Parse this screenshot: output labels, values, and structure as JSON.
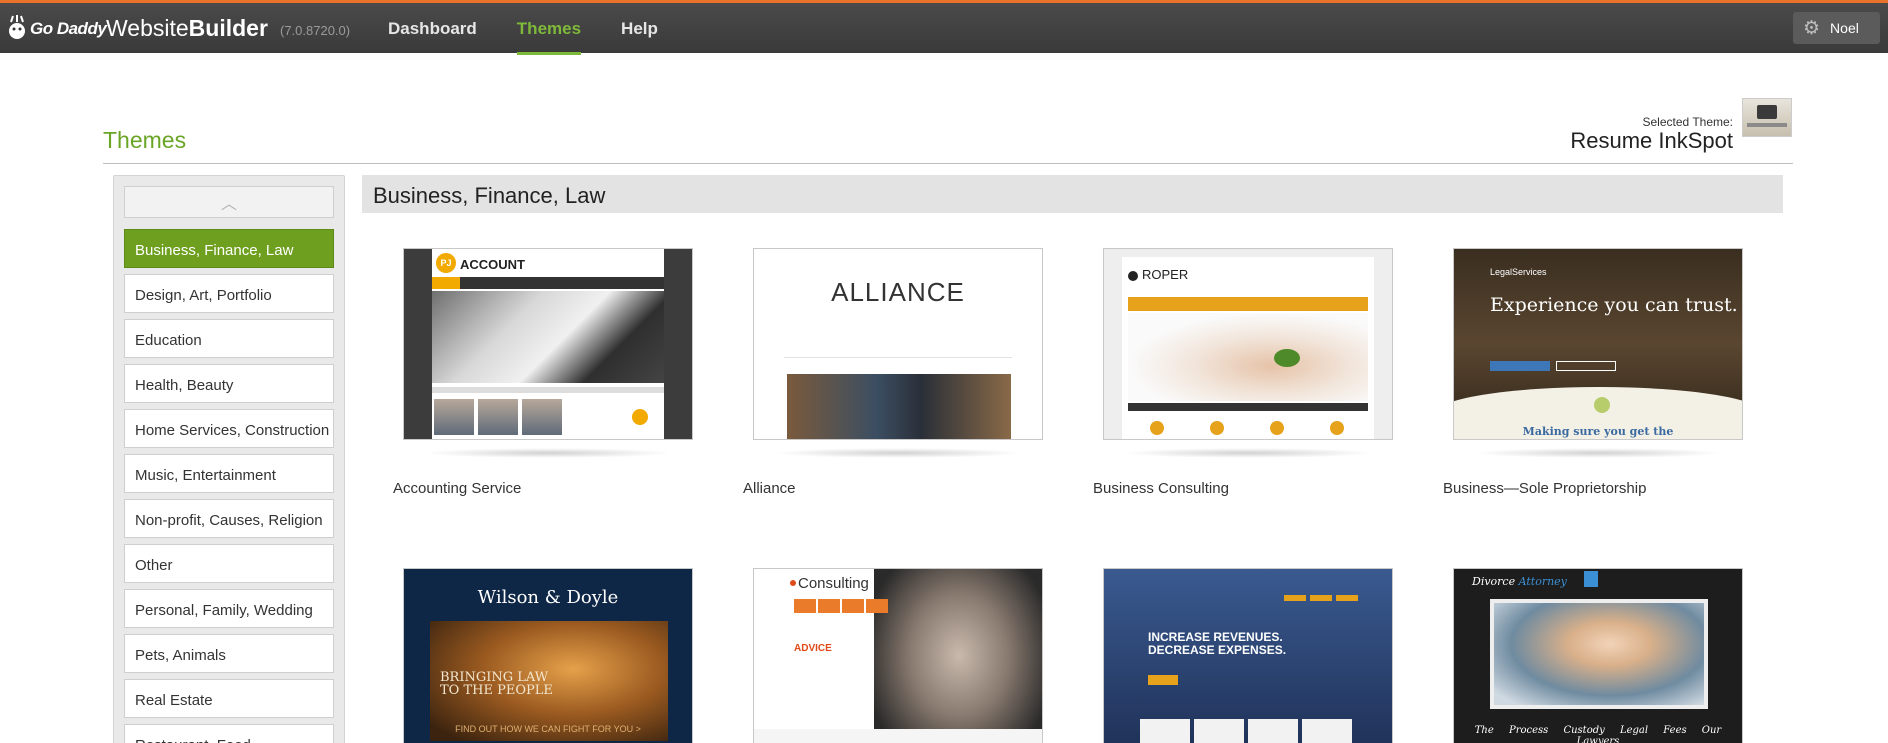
{
  "header": {
    "logo_text": "Go Daddy",
    "brand_light": "Website",
    "brand_bold": "Builder",
    "version": "(7.0.8720.0)",
    "nav": [
      {
        "label": "Dashboard",
        "active": false
      },
      {
        "label": "Themes",
        "active": true
      },
      {
        "label": "Help",
        "active": false
      }
    ],
    "user_name": "Noel",
    "user_icon": "gear-icon"
  },
  "page": {
    "title": "Themes",
    "selected_theme_label": "Selected Theme:",
    "selected_theme_name": "Resume InkSpot"
  },
  "sidebar": {
    "scroll_up_icon": "chevron-up-icon",
    "categories": [
      {
        "label": "Business, Finance, Law",
        "active": true
      },
      {
        "label": "Design, Art, Portfolio",
        "active": false
      },
      {
        "label": "Education",
        "active": false
      },
      {
        "label": "Health, Beauty",
        "active": false
      },
      {
        "label": "Home Services, Construction",
        "active": false
      },
      {
        "label": "Music, Entertainment",
        "active": false
      },
      {
        "label": "Non-profit, Causes, Religion",
        "active": false
      },
      {
        "label": "Other",
        "active": false
      },
      {
        "label": "Personal, Family, Wedding",
        "active": false
      },
      {
        "label": "Pets, Animals",
        "active": false
      },
      {
        "label": "Real Estate",
        "active": false
      },
      {
        "label": "Restaurant, Food",
        "active": false
      }
    ]
  },
  "main": {
    "section_title": "Business, Finance, Law",
    "themes": [
      {
        "name": "Accounting Service",
        "thumb_title": "ACCOUNT",
        "thumb_logo": "PJ"
      },
      {
        "name": "Alliance",
        "thumb_title": "ALLIANCE"
      },
      {
        "name": "Business Consulting",
        "thumb_title": "ROPER"
      },
      {
        "name": "Business—Sole Proprietorship",
        "thumb_logo": "LegalServices",
        "thumb_title": "Experience you can trust.",
        "thumb_sub": "Making sure you get the"
      },
      {
        "name": "",
        "thumb_title": "Wilson & Doyle",
        "thumb_sub": "BRINGING LAW TO THE PEOPLE",
        "thumb_foot": "FIND OUT HOW WE CAN FIGHT FOR YOU >"
      },
      {
        "name": "",
        "thumb_title": "Consulting",
        "thumb_sub": "ADVICE"
      },
      {
        "name": "",
        "thumb_title": "INCREASE REVENUES. DECREASE EXPENSES."
      },
      {
        "name": "",
        "thumb_title": "Divorce",
        "thumb_title_accent": "Attorney",
        "thumb_foot": "The Process Custody Legal Fees Our Lawyers"
      }
    ]
  },
  "colors": {
    "accent_green": "#6aa526",
    "active_category": "#6e9f1e",
    "topbar_accent": "#e8722a"
  }
}
